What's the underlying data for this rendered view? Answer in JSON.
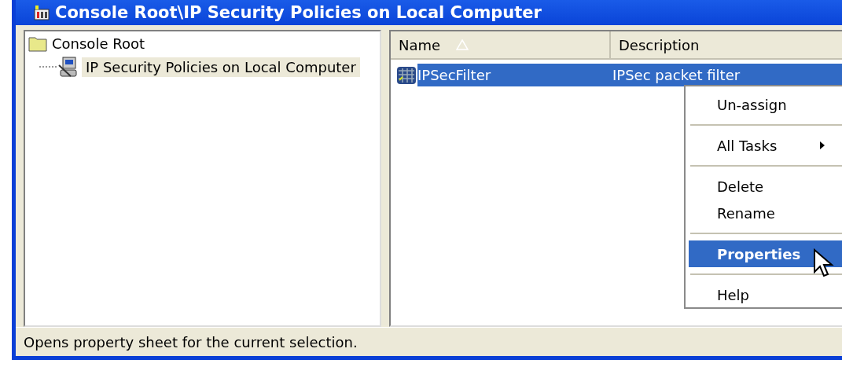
{
  "window": {
    "title": "Console Root\\IP Security Policies on Local Computer"
  },
  "tree": {
    "label": "Console Root",
    "children": [
      {
        "label": "IP Security Policies on Local Computer",
        "selected": true
      }
    ]
  },
  "list": {
    "columns": [
      {
        "label": "Name",
        "sorted": true
      },
      {
        "label": "Description",
        "sorted": false
      }
    ],
    "rows": [
      {
        "name": "IPSecFilter",
        "description": "IPSec packet filter",
        "selected": true
      }
    ]
  },
  "context_menu": {
    "items": [
      {
        "kind": "item",
        "label": "Un-assign",
        "selected": false
      },
      {
        "kind": "separator"
      },
      {
        "kind": "submenu",
        "label": "All Tasks",
        "selected": false
      },
      {
        "kind": "separator"
      },
      {
        "kind": "item",
        "label": "Delete",
        "selected": false
      },
      {
        "kind": "item",
        "label": "Rename",
        "selected": false
      },
      {
        "kind": "separator"
      },
      {
        "kind": "item",
        "label": "Properties",
        "selected": true
      },
      {
        "kind": "separator"
      },
      {
        "kind": "item",
        "label": "Help",
        "selected": false
      }
    ]
  },
  "status_bar": {
    "text": "Opens property sheet for the current selection."
  }
}
